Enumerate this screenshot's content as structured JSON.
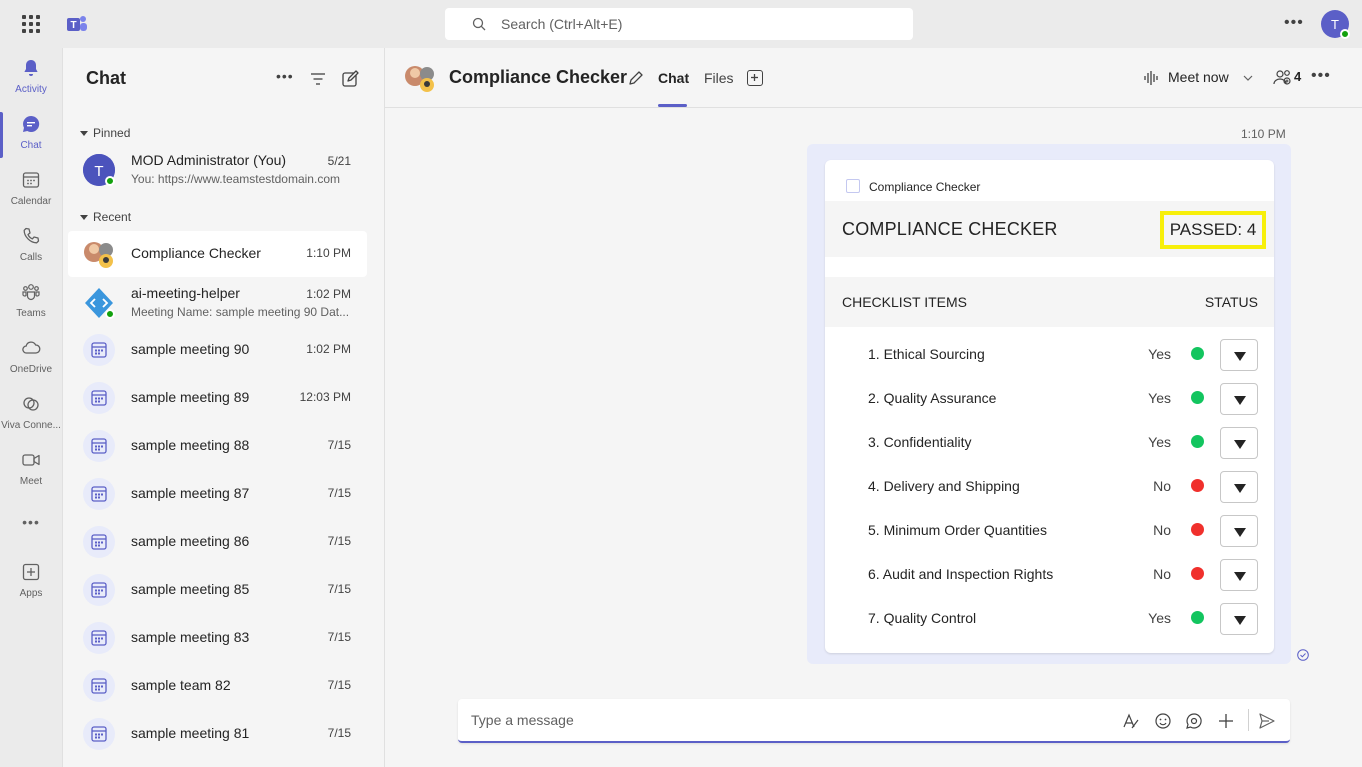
{
  "search": {
    "placeholder": "Search (Ctrl+Alt+E)"
  },
  "rail": [
    {
      "label": "Activity",
      "icon": "bell-icon"
    },
    {
      "label": "Chat",
      "icon": "chat-icon"
    },
    {
      "label": "Calendar",
      "icon": "calendar-icon"
    },
    {
      "label": "Calls",
      "icon": "phone-icon"
    },
    {
      "label": "Teams",
      "icon": "teams-icon"
    },
    {
      "label": "OneDrive",
      "icon": "cloud-icon"
    },
    {
      "label": "Viva Conne...",
      "icon": "viva-icon"
    },
    {
      "label": "Meet",
      "icon": "video-icon"
    },
    {
      "label": "Apps",
      "icon": "apps-icon"
    }
  ],
  "chatlist": {
    "title": "Chat",
    "pinned_label": "Pinned",
    "recent_label": "Recent",
    "pinned": [
      {
        "name": "MOD Administrator (You)",
        "sub": "You: https://www.teamstestdomain.com",
        "time": "5/21"
      }
    ],
    "recent": [
      {
        "name": "Compliance Checker",
        "time": "1:10 PM"
      },
      {
        "name": "ai-meeting-helper",
        "sub": "Meeting Name: sample meeting 90 Dat...",
        "time": "1:02 PM"
      },
      {
        "name": "sample meeting 90",
        "time": "1:02 PM"
      },
      {
        "name": "sample meeting 89",
        "time": "12:03 PM"
      },
      {
        "name": "sample meeting 88",
        "time": "7/15"
      },
      {
        "name": "sample meeting 87",
        "time": "7/15"
      },
      {
        "name": "sample meeting 86",
        "time": "7/15"
      },
      {
        "name": "sample meeting 85",
        "time": "7/15"
      },
      {
        "name": "sample meeting 83",
        "time": "7/15"
      },
      {
        "name": "sample team 82",
        "time": "7/15"
      },
      {
        "name": "sample meeting 81",
        "time": "7/15"
      }
    ]
  },
  "header": {
    "title": "Compliance Checker",
    "tab_chat": "Chat",
    "tab_files": "Files",
    "meet_now": "Meet now",
    "participants": "4"
  },
  "message": {
    "time": "1:10 PM",
    "card_app": "Compliance Checker",
    "card_title": "COMPLIANCE CHECKER",
    "passed": "PASSED: 4",
    "col_items": "CHECKLIST ITEMS",
    "col_status": "STATUS",
    "rows": [
      {
        "item": "1. Ethical Sourcing",
        "status": "Yes",
        "color": "#13c55f"
      },
      {
        "item": "2. Quality Assurance",
        "status": "Yes",
        "color": "#13c55f"
      },
      {
        "item": "3. Confidentiality",
        "status": "Yes",
        "color": "#13c55f"
      },
      {
        "item": "4. Delivery and Shipping",
        "status": "No",
        "color": "#f0302c"
      },
      {
        "item": "5. Minimum Order Quantities",
        "status": "No",
        "color": "#f0302c"
      },
      {
        "item": "6. Audit and Inspection Rights",
        "status": "No",
        "color": "#f0302c"
      },
      {
        "item": "7. Quality Control",
        "status": "Yes",
        "color": "#13c55f"
      }
    ]
  },
  "composer": {
    "placeholder": "Type a message"
  },
  "colors": {
    "accent": "#5b5fc7",
    "highlight": "#f7ef0a",
    "yes": "#13c55f",
    "no": "#f0302c"
  }
}
